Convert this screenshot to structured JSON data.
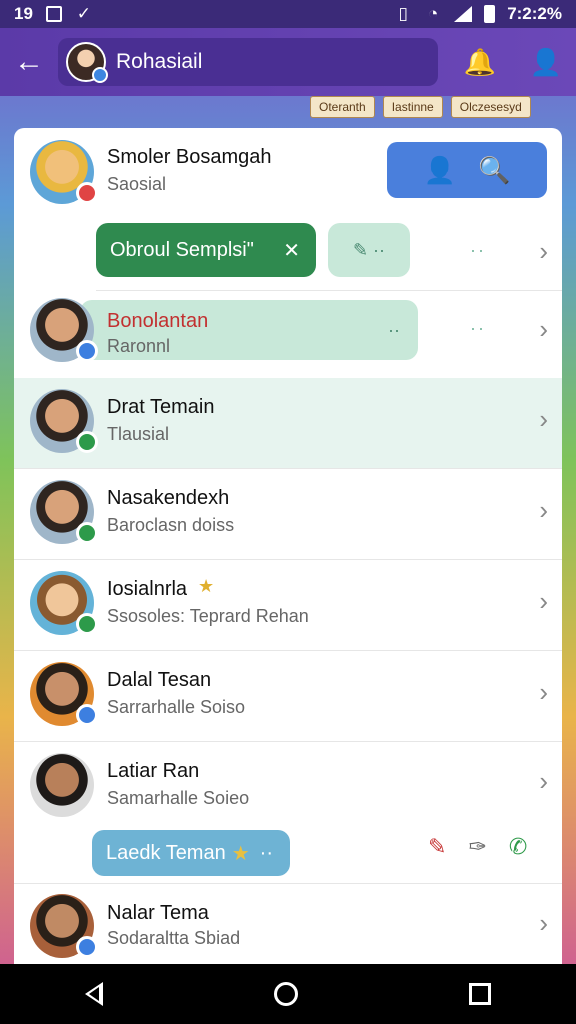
{
  "status_bar": {
    "time": "7:2:2%",
    "left_icons": [
      "notification-count-19",
      "box-icon",
      "check-icon"
    ],
    "count_label": "19"
  },
  "app_bar": {
    "title": "Rohasiail"
  },
  "backdrop_tabs": [
    "Oteranth",
    "Iastinne",
    "Olczesesyd"
  ],
  "rows": [
    {
      "name": "Smoler Bosamgah",
      "subtitle": "Saosial"
    },
    {
      "name": "Bonolantan",
      "subtitle": "Raronnl"
    },
    {
      "name": "Drat Temain",
      "subtitle": "Tlausial"
    },
    {
      "name": "Nasakendexh",
      "subtitle": "Baroclasn doiss"
    },
    {
      "name": "Iosialnrla",
      "subtitle": "Ssosoles: Teprard Rehan"
    },
    {
      "name": "Dalal Tesan",
      "subtitle": "Sarrarhalle Soiso"
    },
    {
      "name": "Latiar Ran",
      "subtitle": "Samarhalle Soieo"
    },
    {
      "name": "Nalar Tema",
      "subtitle": "Sodaraltta Sbiad"
    }
  ],
  "bubbles": {
    "green": "Obroul Semplsi\"",
    "blue": "Laedk Teman"
  },
  "colors": {
    "accent_purple": "#5b3aa8",
    "search_blue": "#4a7fdc",
    "bubble_green": "#2f8a4f",
    "bubble_mint": "#c8e8d9",
    "bubble_blue": "#6eb3d4"
  }
}
